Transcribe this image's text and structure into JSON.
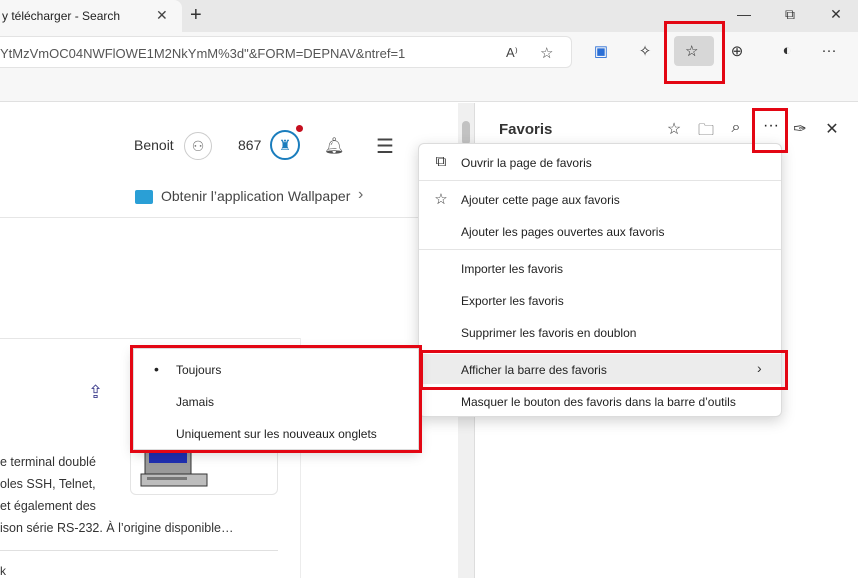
{
  "browser": {
    "tab_title": "y télécharger - Search",
    "tab_close": "✕",
    "new_tab": "+",
    "window": {
      "minimize": "—",
      "restore": "⧉",
      "close": "✕"
    },
    "url": "YtMzVmOC04NWFlOWE1M2NkYmM%3d\"&FORM=DEPNAV&ntref=1",
    "read_aloud_icon": "A⁾",
    "toolbar_more": "···"
  },
  "page": {
    "user_name": "Benoit",
    "points": "867",
    "app_link": "Obtenir l’application Wallpaper",
    "snippet_lines": [
      "e terminal doublé",
      "oles SSH, Telnet,",
      "et également des",
      "ison série RS-232. À l’origine disponible…"
    ],
    "bottom_fragment": "k"
  },
  "favorites_pane": {
    "title": "Favoris",
    "more_label": "···"
  },
  "menu": {
    "items": [
      {
        "label": "Ouvrir la page de favoris",
        "icon": "open-external-icon"
      },
      {
        "label": "Ajouter cette page aux favoris",
        "icon": "add-favorite-icon"
      },
      {
        "label": "Ajouter les pages ouvertes aux favoris",
        "icon": ""
      },
      {
        "label": "Importer les favoris",
        "icon": ""
      },
      {
        "label": "Exporter les favoris",
        "icon": ""
      },
      {
        "label": "Supprimer les favoris en doublon",
        "icon": ""
      },
      {
        "label": "Afficher la barre des favoris",
        "icon": "",
        "has_submenu": true,
        "highlighted": true
      },
      {
        "label": "Masquer le bouton des favoris dans la barre d’outils",
        "icon": ""
      }
    ]
  },
  "submenu": {
    "items": [
      {
        "label": "Toujours",
        "selected": true
      },
      {
        "label": "Jamais",
        "selected": false
      },
      {
        "label": "Uniquement sur les nouveaux onglets",
        "selected": false
      }
    ],
    "bullet": "•"
  },
  "colors": {
    "annotation_red": "#e30613",
    "accent_blue": "#1a7dbd",
    "notification_red": "#c50f1f",
    "menu_highlight": "#ececec"
  }
}
